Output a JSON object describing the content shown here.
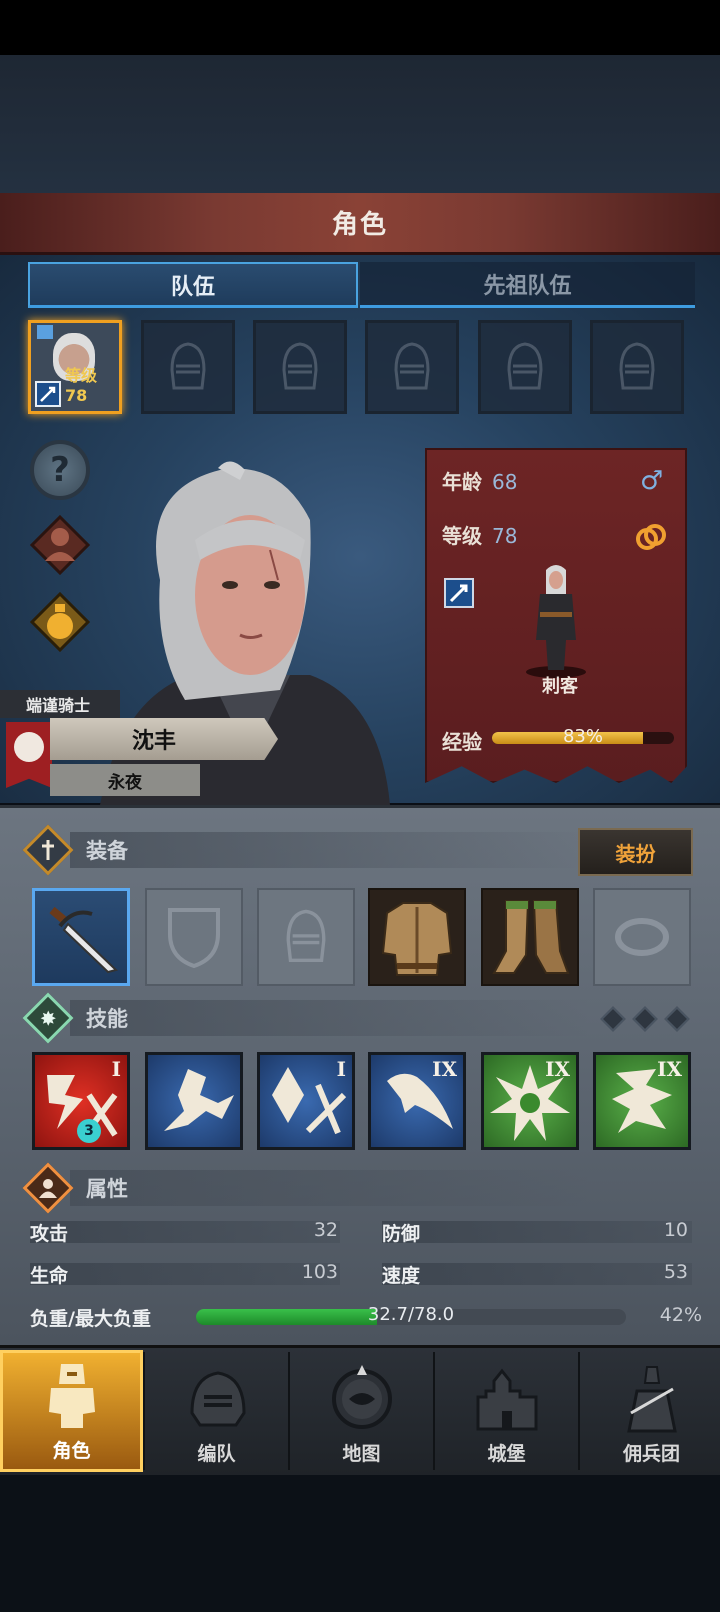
{
  "header": {
    "title": "角色"
  },
  "tabs": [
    {
      "label": "队伍",
      "active": true
    },
    {
      "label": "先祖队伍",
      "active": false
    }
  ],
  "party": {
    "member": {
      "level_label": "等级78"
    },
    "empty_slots": 5
  },
  "sidebar": {
    "icons": [
      "help-icon",
      "character-portrait-icon",
      "potion-icon"
    ]
  },
  "hero": {
    "title": "端谨骑士",
    "name": "沈丰",
    "house": "永夜"
  },
  "info": {
    "age_label": "年龄",
    "age_value": "68",
    "level_label": "等级",
    "level_value": "78",
    "gender_icon": "♂",
    "class_name": "刺客",
    "exp_label": "经验",
    "exp_percent": 83,
    "exp_text": "83%",
    "accent_panel": "#6d2525"
  },
  "equipment": {
    "title": "装备",
    "dress_button": "装扮",
    "slots": [
      "dagger",
      "shield-empty",
      "helmet-empty",
      "armor",
      "boots",
      "ring-empty"
    ]
  },
  "skills": {
    "title": "技能",
    "items": [
      {
        "color": "red",
        "rank": "I",
        "badge": "3",
        "icon": "slash-icon"
      },
      {
        "color": "blue",
        "rank": "",
        "badge": "",
        "icon": "dash-icon"
      },
      {
        "color": "blue",
        "rank": "I",
        "badge": "",
        "icon": "crystal-strike-icon"
      },
      {
        "color": "blue",
        "rank": "IX",
        "badge": "",
        "icon": "wing-icon"
      },
      {
        "color": "green",
        "rank": "IX",
        "badge": "",
        "icon": "burst-icon"
      },
      {
        "color": "green",
        "rank": "IX",
        "badge": "",
        "icon": "claw-icon"
      }
    ]
  },
  "attributes": {
    "title": "属性",
    "attack_label": "攻击",
    "attack_value": "32",
    "defense_label": "防御",
    "defense_value": "10",
    "hp_label": "生命",
    "hp_value": "103",
    "speed_label": "速度",
    "speed_value": "53",
    "load_label": "负重/最大负重",
    "load_text": "32.7/78.0",
    "load_percent_text": "42%",
    "load_percent": 42
  },
  "nav": [
    {
      "label": "角色",
      "active": true
    },
    {
      "label": "编队",
      "active": false
    },
    {
      "label": "地图",
      "active": false
    },
    {
      "label": "城堡",
      "active": false
    },
    {
      "label": "佣兵团",
      "active": false
    }
  ]
}
